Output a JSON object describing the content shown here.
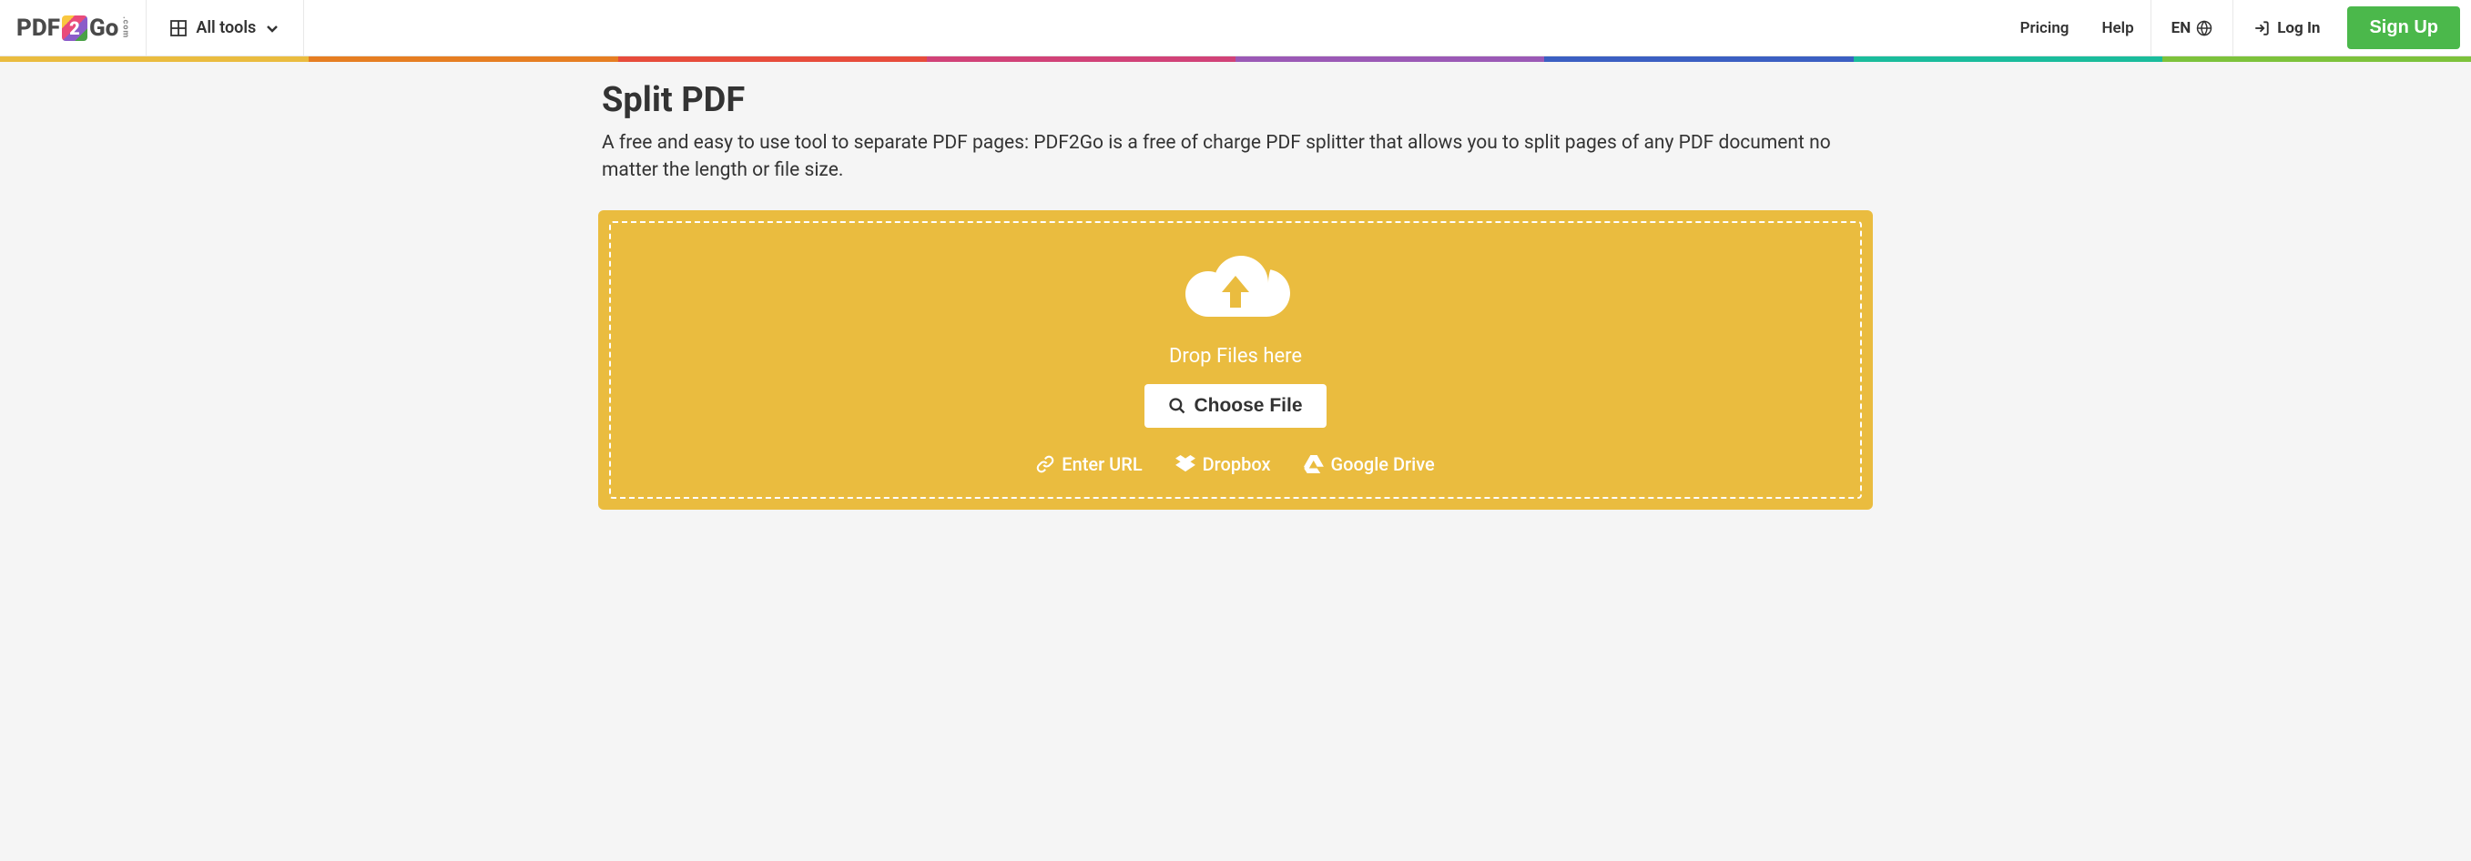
{
  "header": {
    "logo_pdf": "PDF",
    "logo_go": "Go",
    "logo_com": ".com",
    "all_tools": "All tools",
    "pricing": "Pricing",
    "help": "Help",
    "lang": "EN",
    "login": "Log In",
    "signup": "Sign Up"
  },
  "rainbow_colors": [
    "#eabc3f",
    "#e67e22",
    "#e74c3c",
    "#d14278",
    "#9b59b6",
    "#3b5fc2",
    "#1abc9c",
    "#7dc23b"
  ],
  "page": {
    "title": "Split PDF",
    "description": "A free and easy to use tool to separate PDF pages: PDF2Go is a free of charge PDF splitter that allows you to split pages of any PDF document no matter the length or file size."
  },
  "dropzone": {
    "drop_text": "Drop Files here",
    "choose_file": "Choose File",
    "enter_url": "Enter URL",
    "dropbox": "Dropbox",
    "google_drive": "Google Drive"
  }
}
